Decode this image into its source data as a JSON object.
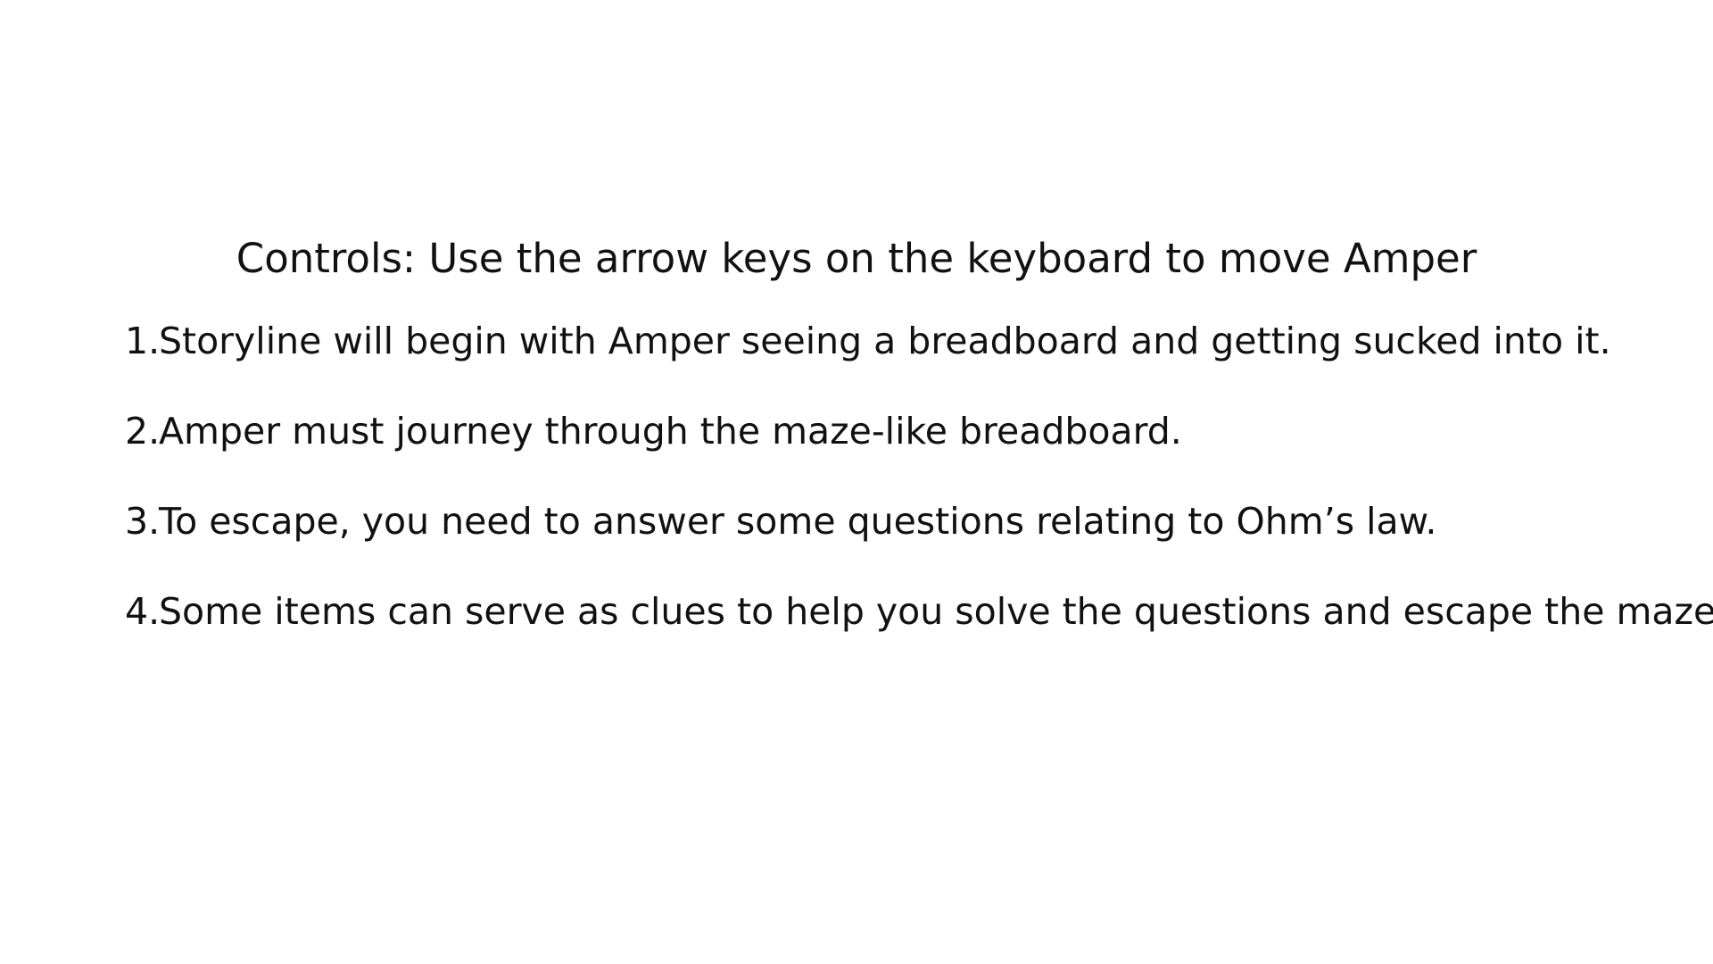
{
  "heading": "Controls: Use the arrow keys on the keyboard to move Amper",
  "steps": [
    {
      "number": "1.",
      "text": "Storyline will begin with Amper seeing a breadboard and getting sucked into it."
    },
    {
      "number": "2.",
      "text": "Amper must journey through the maze-like breadboard."
    },
    {
      "number": "3.",
      "text": "To escape, you need to answer some questions relating to Ohm’s law."
    },
    {
      "number": "4.",
      "text": "Some items can serve as clues to help you solve the questions and escape the maze."
    }
  ]
}
